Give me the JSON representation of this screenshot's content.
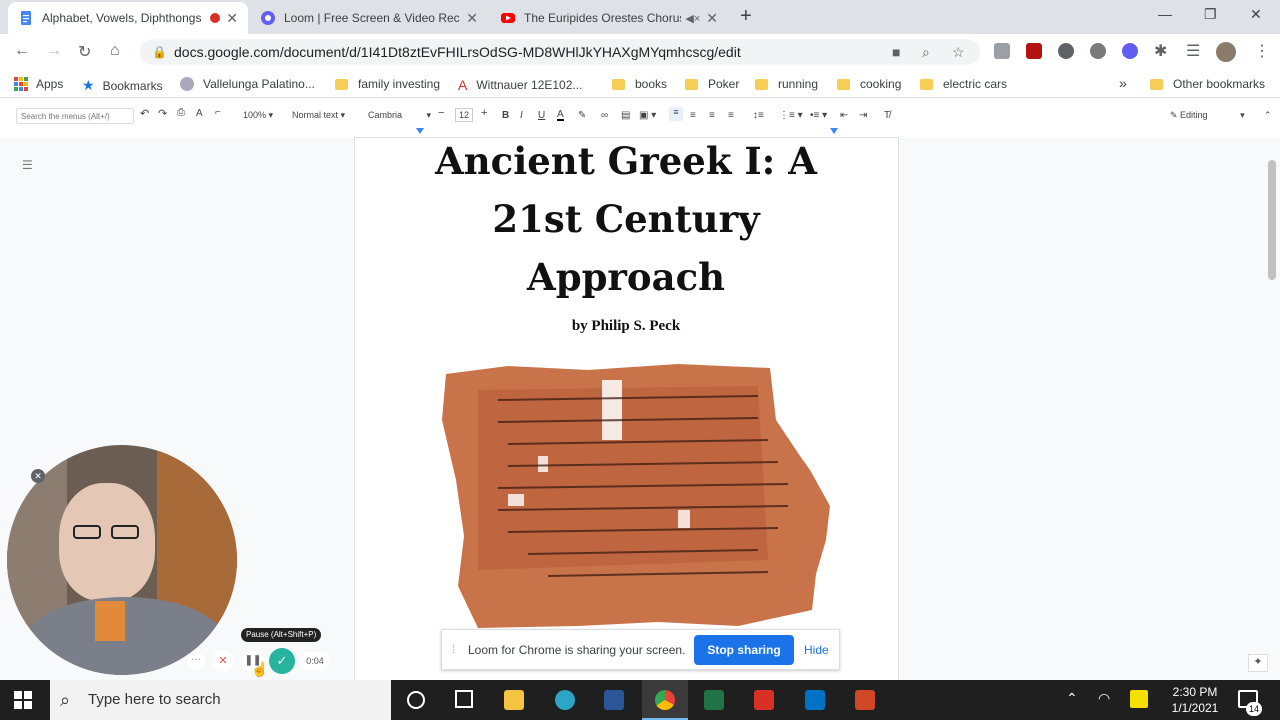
{
  "tabs": [
    {
      "title": "Alphabet, Vowels, Diphthongs",
      "active": true,
      "favicon": "docs-icon"
    },
    {
      "title": "Loom | Free Screen & Video Recording",
      "active": false,
      "favicon": "loom-icon"
    },
    {
      "title": "The Euripides Orestes Chorus",
      "active": false,
      "favicon": "youtube-icon"
    }
  ],
  "address": {
    "url": "docs.google.com/document/d/1I41Dt8ztEvFHILrsOdSG-MD8WHlJkYHAXgMYqmhcscg/edit"
  },
  "bookmarks": [
    {
      "label": "Apps"
    },
    {
      "label": "Bookmarks"
    },
    {
      "label": "Vallelunga Palatino..."
    },
    {
      "label": "family investing"
    },
    {
      "label": "Wittnauer 12E102..."
    },
    {
      "label": "books"
    },
    {
      "label": "Poker"
    },
    {
      "label": "running"
    },
    {
      "label": "cooking"
    },
    {
      "label": "electric cars"
    },
    {
      "label": "Other bookmarks"
    }
  ],
  "docs_toolbar": {
    "search_placeholder": "Search the menus (Alt+/)",
    "zoom": "100%",
    "style": "Normal text",
    "font": "Cambria",
    "font_size": "12",
    "mode": "Editing"
  },
  "document": {
    "title_line1": "Ancient Greek I: A",
    "title_line2": "21st Century",
    "title_line3": "Approach",
    "author": "by Philip S. Peck"
  },
  "loom": {
    "share_text": "Loom for Chrome is sharing your screen.",
    "stop_label": "Stop sharing",
    "hide_label": "Hide",
    "tooltip": "Pause (Alt+Shift+P)",
    "timer": "0:04"
  },
  "taskbar": {
    "search_placeholder": "Type here to search",
    "time": "2:30 PM",
    "date": "1/1/2021",
    "notification_count": "14"
  },
  "colors": {
    "accent": "#1a73e8",
    "tabstrip": "#dee1e6",
    "loom_green": "#27b49e"
  }
}
